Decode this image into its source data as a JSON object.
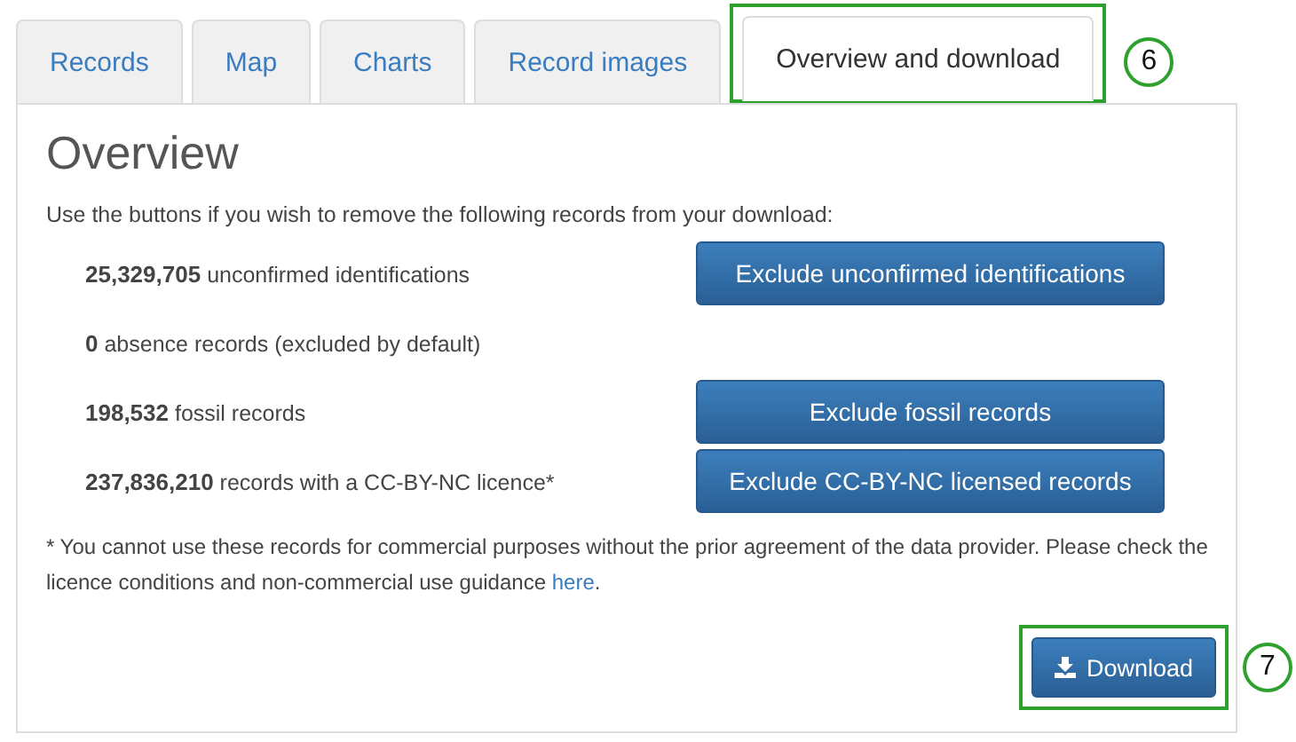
{
  "tabs": [
    {
      "label": "Records",
      "selected": false
    },
    {
      "label": "Map",
      "selected": false
    },
    {
      "label": "Charts",
      "selected": false
    },
    {
      "label": "Record images",
      "selected": false
    },
    {
      "label": "Overview and download",
      "selected": true,
      "callout": "6"
    }
  ],
  "heading": "Overview",
  "intro": "Use the buttons if you wish to remove the following records from your download:",
  "rows": [
    {
      "count": "25,329,705",
      "text": "unconfirmed identifications",
      "button": "Exclude unconfirmed identifications"
    },
    {
      "count": "0",
      "text": "absence records (excluded by default)"
    },
    {
      "count": "198,532",
      "text": "fossil records",
      "button": "Exclude fossil records"
    },
    {
      "count": "237,836,210",
      "text": "records with a CC-BY-NC licence*",
      "button": "Exclude CC-BY-NC licensed records"
    }
  ],
  "footnote": "* You cannot use these records for commercial purposes without the prior agreement of the data provider. Please check the licence conditions and non-commercial use guidance",
  "footnote_link": "here",
  "footnote_end": ".",
  "download": {
    "label": "Download",
    "callout": "7"
  }
}
